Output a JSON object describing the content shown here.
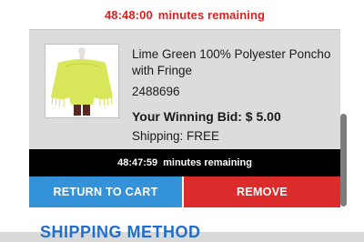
{
  "top_timer": {
    "time": "48:48:00",
    "label": "minutes remaining"
  },
  "item": {
    "title": "Lime Green 100% Polyester Poncho with Fringe",
    "sku": "2488696",
    "winning_bid": "Your Winning Bid: $ 5.00",
    "shipping": "Shipping: FREE",
    "image_icon": "poncho-product-photo"
  },
  "item_timer": {
    "time": "48:47:59",
    "label": "minutes remaining"
  },
  "buttons": {
    "return_to_cart": "RETURN TO CART",
    "remove": "REMOVE"
  },
  "next_section": {
    "heading": "SHIPPING METHOD"
  },
  "colors": {
    "timer_red": "#e02020",
    "return_blue": "#3392d8",
    "remove_red": "#dc2b2b",
    "heading_blue": "#1e6fd0"
  }
}
